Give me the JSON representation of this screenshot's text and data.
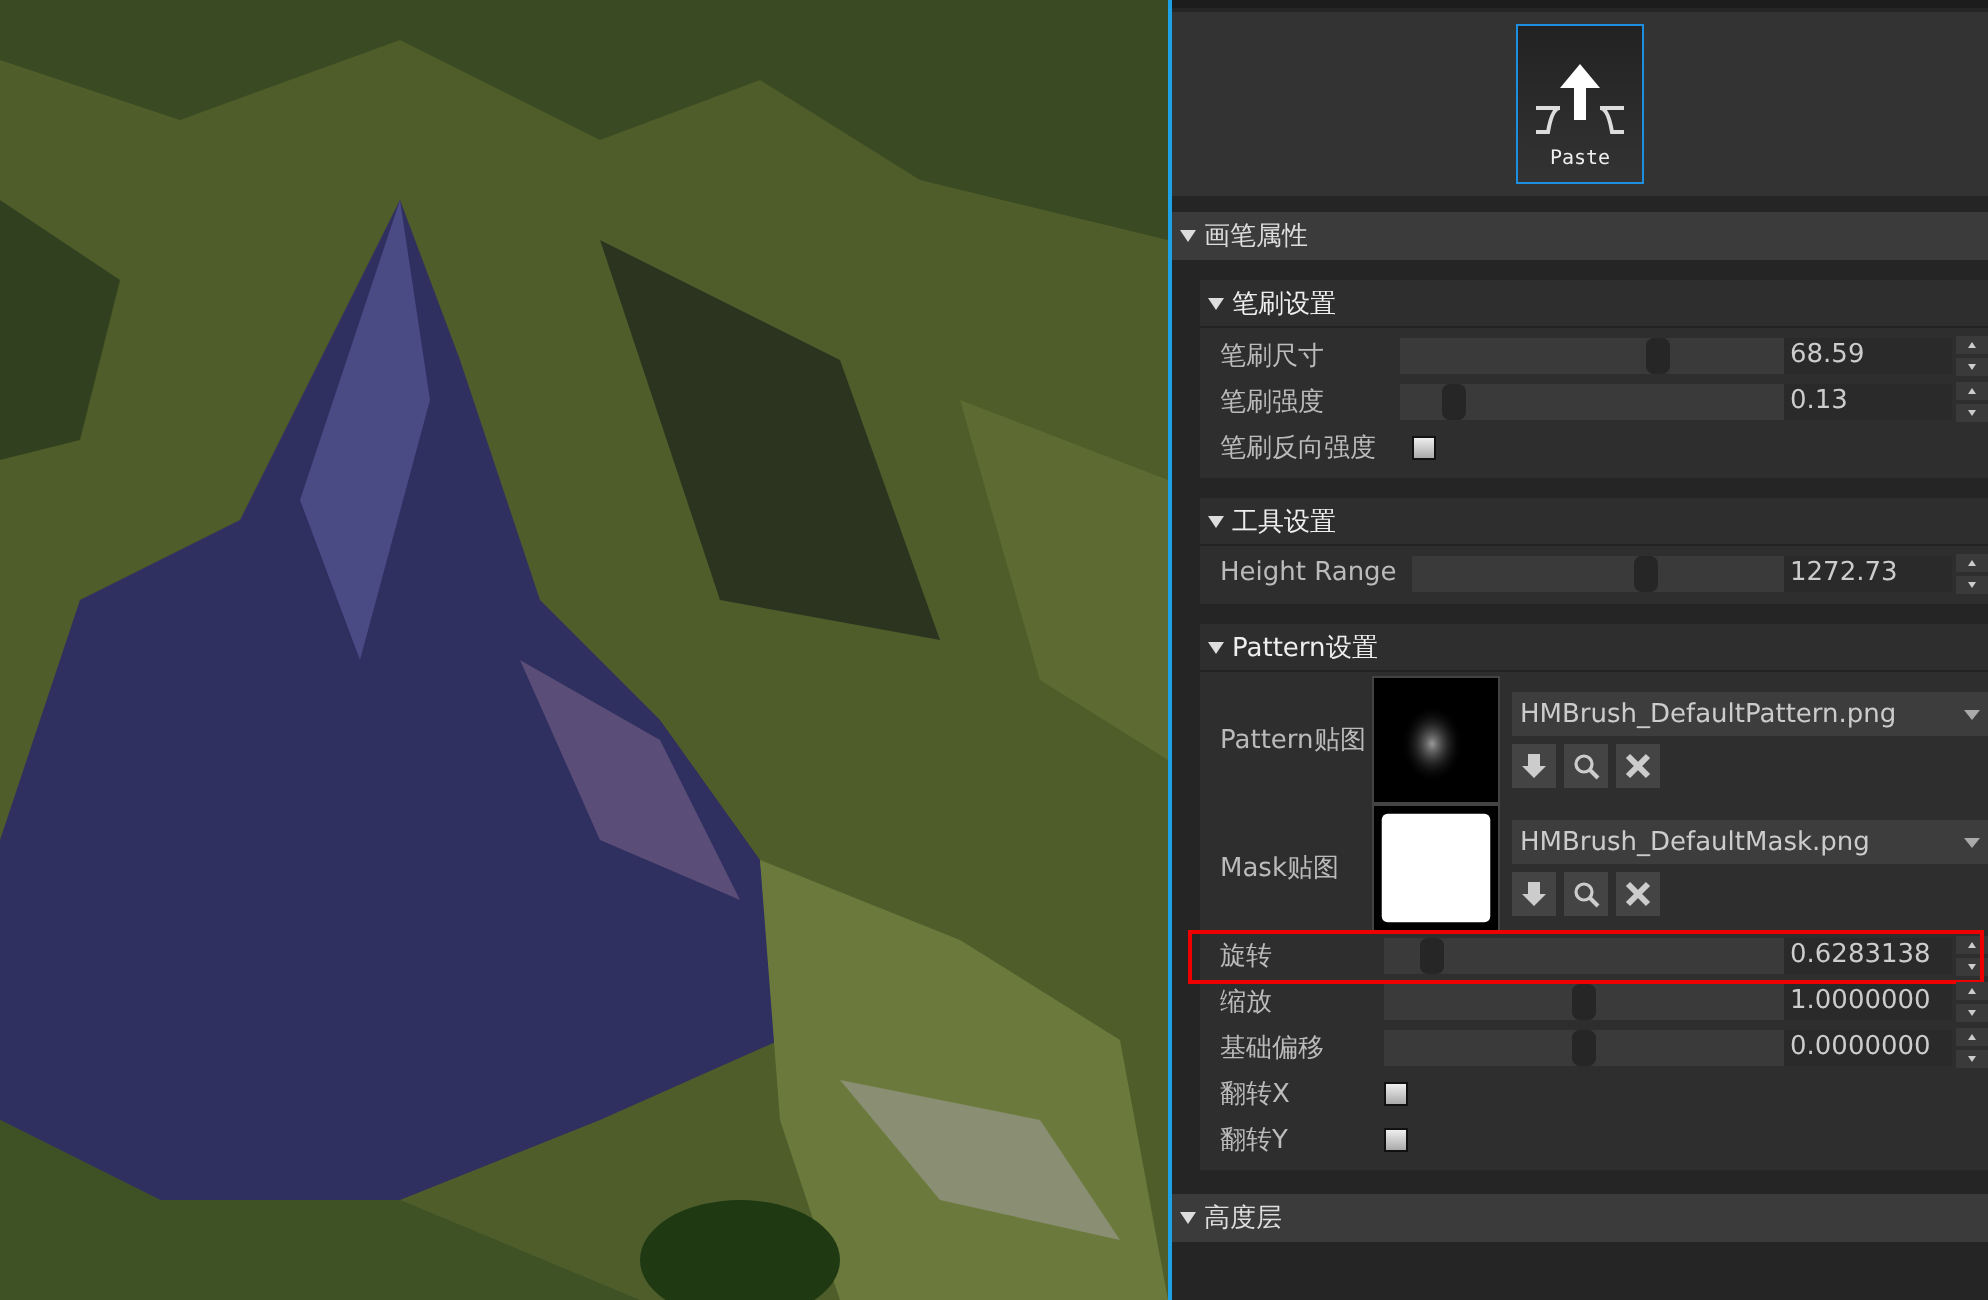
{
  "tool": {
    "label": "Paste",
    "selected": true
  },
  "brush_properties": {
    "title": "画笔属性",
    "expanded": true,
    "groups": [
      {
        "title": "笔刷设置",
        "expanded": true,
        "rows": [
          {
            "kind": "slider",
            "label": "笔刷尺寸",
            "level": 0.67,
            "value": "68.59"
          },
          {
            "kind": "slider",
            "label": "笔刷强度",
            "level": 0.14,
            "value": "0.13"
          },
          {
            "kind": "checkbox",
            "label": "笔刷反向强度",
            "checked": false
          }
        ]
      },
      {
        "title": "工具设置",
        "expanded": true,
        "rows": [
          {
            "kind": "slider",
            "label": "Height Range",
            "level": 0.63,
            "value": "1272.73"
          }
        ]
      },
      {
        "title": "Pattern设置",
        "expanded": true,
        "rows": [
          {
            "kind": "pattern",
            "label": "Pattern贴图",
            "file": "HMBrush_DefaultPattern.png"
          },
          {
            "kind": "mask",
            "label": "Mask贴图",
            "file": "HMBrush_DefaultMask.png"
          },
          {
            "kind": "slider",
            "label": "旋转",
            "level": 0.12,
            "value": "0.6283138",
            "highlighted": true
          },
          {
            "kind": "slider",
            "label": "缩放",
            "level": 0.5,
            "value": "1.0000000"
          },
          {
            "kind": "slider",
            "label": "基础偏移",
            "level": 0.5,
            "value": "0.0000000"
          },
          {
            "kind": "checkbox",
            "label": "翻转X",
            "checked": false
          },
          {
            "kind": "checkbox",
            "label": "翻转Y",
            "checked": false
          }
        ]
      }
    ]
  },
  "height_layers": {
    "title": "高度层",
    "expanded": true
  }
}
